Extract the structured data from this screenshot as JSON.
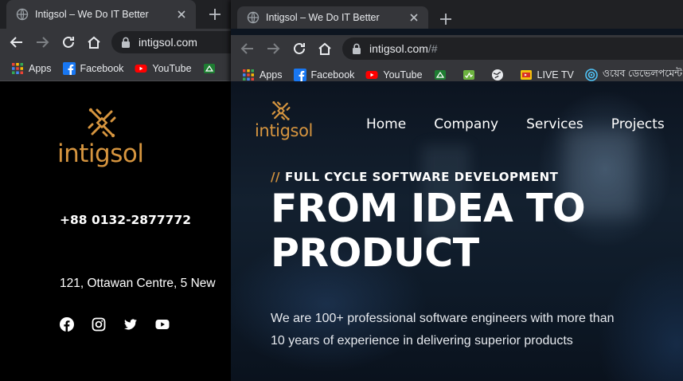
{
  "left_window": {
    "tab_title": "Intigsol – We Do IT Better",
    "url": "intigsol.com",
    "bookmarks": [
      "Apps",
      "Facebook",
      "YouTube"
    ],
    "page": {
      "logo_text": "intigsol",
      "phone": "+88 0132-2877772",
      "address": "121, Ottawan Centre, 5 New",
      "social_icons": [
        "facebook-icon",
        "instagram-icon",
        "twitter-icon",
        "youtube-icon"
      ]
    }
  },
  "right_window": {
    "tab_title": "Intigsol – We Do IT Better",
    "url_main": "intigsol.com",
    "url_tail": "/#",
    "bookmarks": [
      "Apps",
      "Facebook",
      "YouTube",
      "",
      "",
      "",
      "LIVE TV",
      "ওয়েব ডেভেলপমেন্ট..."
    ],
    "page": {
      "logo_text": "intigsol",
      "nav": [
        "Home",
        "Company",
        "Services",
        "Projects"
      ],
      "eyebrow_slashes": "//",
      "eyebrow": "FULL CYCLE SOFTWARE DEVELOPMENT",
      "headline_line1": "FROM IDEA TO",
      "headline_line2": "PRODUCT",
      "desc_line1": "We are 100+ professional software engineers with more than",
      "desc_line2": "10 years of experience in delivering superior products"
    }
  },
  "colors": {
    "brand_orange": "#d6953f",
    "chrome_tabstrip": "#202124",
    "chrome_toolbar": "#35363a"
  }
}
